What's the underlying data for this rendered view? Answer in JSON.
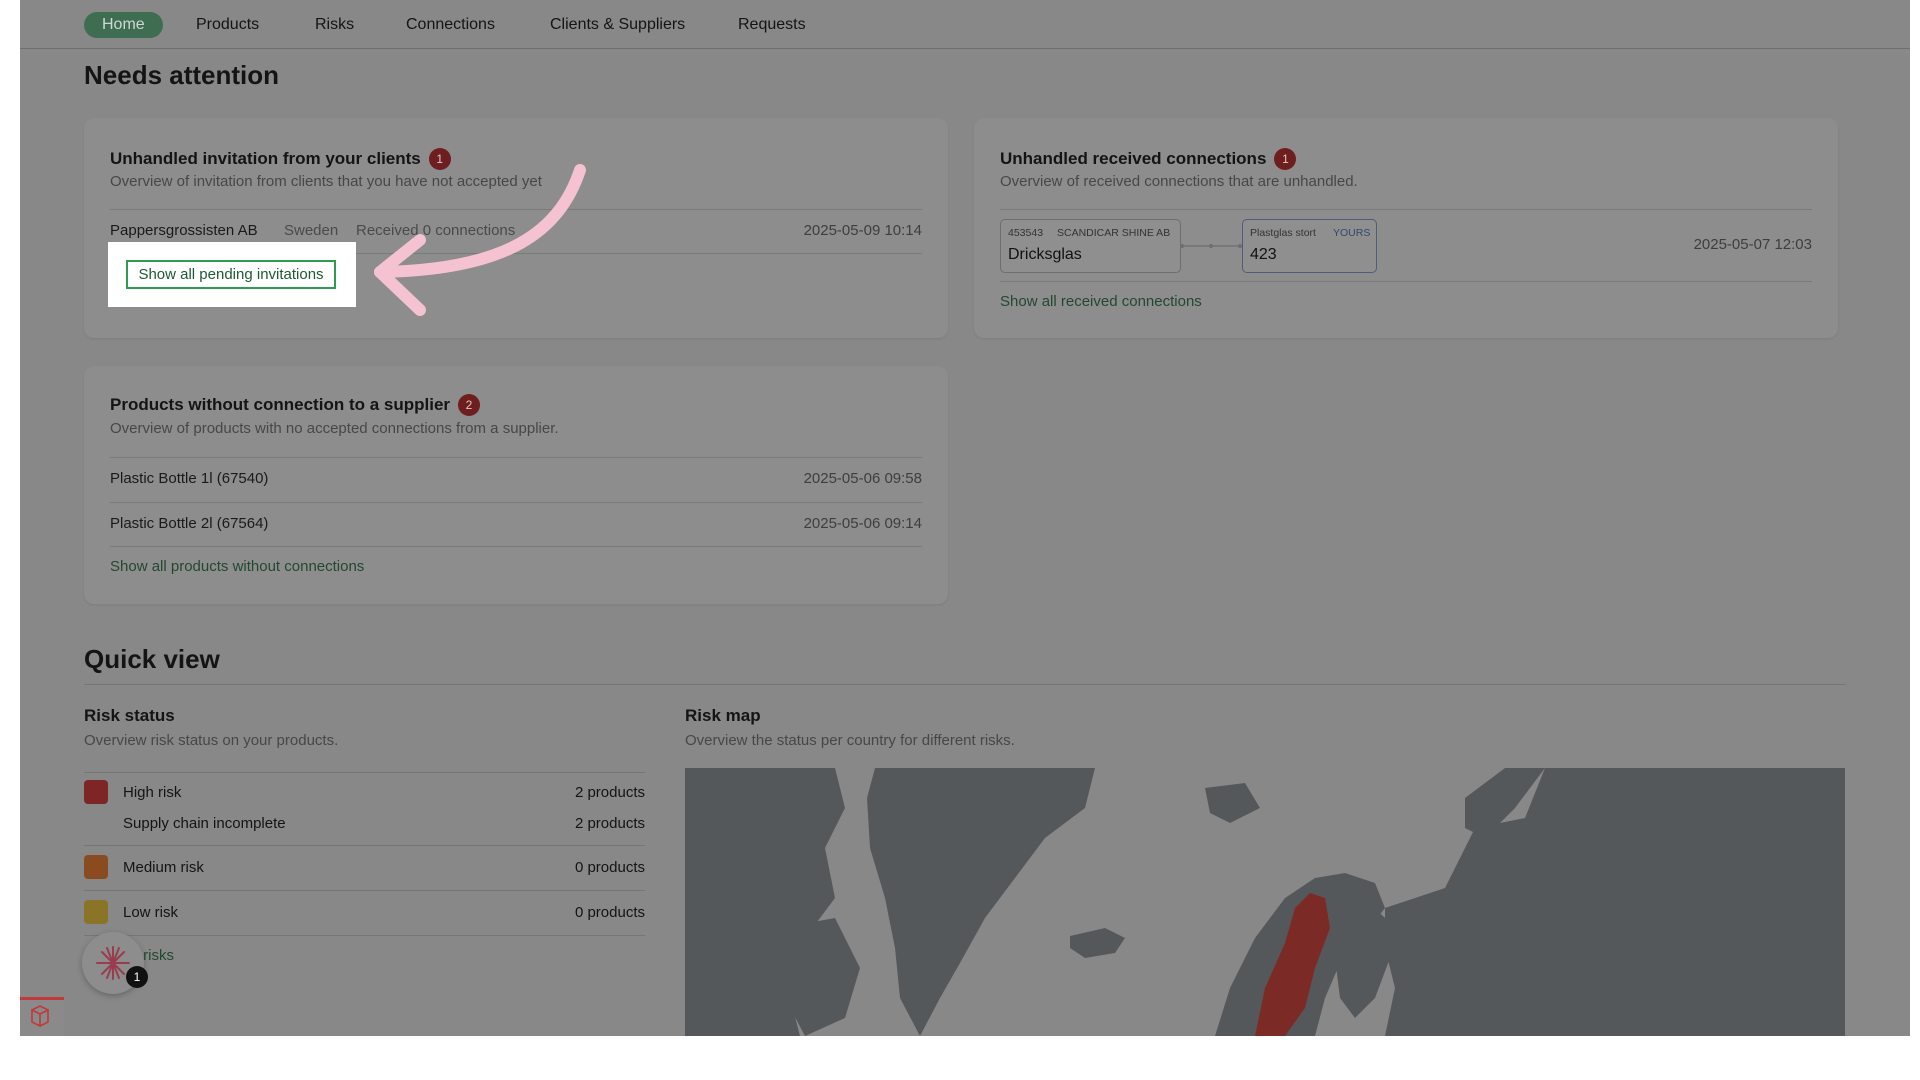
{
  "nav": {
    "items": [
      {
        "label": "Home",
        "active": true
      },
      {
        "label": "Products"
      },
      {
        "label": "Risks"
      },
      {
        "label": "Connections"
      },
      {
        "label": "Clients & Suppliers"
      },
      {
        "label": "Requests"
      }
    ]
  },
  "attention": {
    "title": "Needs attention",
    "invitations": {
      "title": "Unhandled invitation from your clients",
      "count": "1",
      "subtitle": "Overview of invitation from clients that you have not accepted yet",
      "row": {
        "company": "Pappersgrossisten AB",
        "country": "Sweden",
        "status": "Received 0 connections",
        "date": "2025-05-09 10:14"
      },
      "link": "Show all pending invitations"
    },
    "connections": {
      "title": "Unhandled received connections",
      "count": "1",
      "subtitle": "Overview of received connections that are unhandled.",
      "from": {
        "id": "453543",
        "company": "SCANDICAR SHINE AB",
        "product": "Dricksglas"
      },
      "to": {
        "name": "Plastglas stort",
        "tag": "YOURS",
        "value": "423"
      },
      "date": "2025-05-07 12:03",
      "link": "Show all received connections"
    },
    "products": {
      "title": "Products without connection to a supplier",
      "count": "2",
      "subtitle": "Overview of products with no accepted connections from a supplier.",
      "rows": [
        {
          "name": "Plastic Bottle 1l (67540)",
          "date": "2025-05-06 09:58"
        },
        {
          "name": "Plastic Bottle 2l (67564)",
          "date": "2025-05-06 09:14"
        }
      ],
      "link": "Show all products without connections"
    }
  },
  "quickview": {
    "title": "Quick view",
    "risk_status": {
      "title": "Risk status",
      "subtitle": "Overview risk status on your products.",
      "high": {
        "label": "High risk",
        "count": "2 products",
        "color": "#7e2626"
      },
      "supply": {
        "label": "Supply chain incomplete",
        "count": "2 products"
      },
      "medium": {
        "label": "Medium risk",
        "count": "0 products",
        "color": "#8a4c1e"
      },
      "low": {
        "label": "Low risk",
        "count": "0 products",
        "color": "#8a7428"
      },
      "link": "all risks"
    },
    "risk_map": {
      "title": "Risk map",
      "subtitle": "Overview the status per country for different risks.",
      "colors": {
        "land": "#55585b",
        "sweden": "#7c2a26"
      }
    }
  },
  "widget": {
    "badge": "1"
  }
}
